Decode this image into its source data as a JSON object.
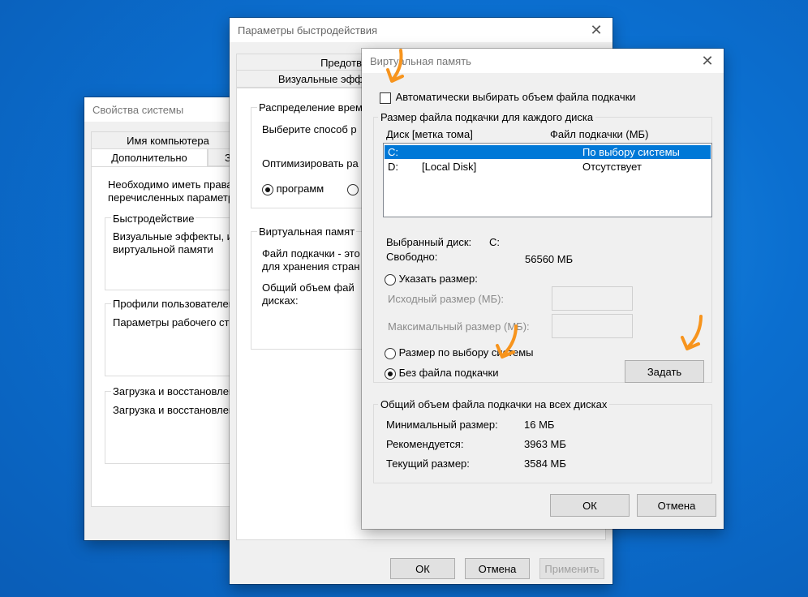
{
  "system_props": {
    "title": "Свойства системы",
    "tab_computer_name": "Имя компьютера",
    "tab_advanced": "Дополнительно",
    "tab_partial": "З",
    "intro_line1": "Необходимо иметь права",
    "intro_line2": "перечисленных параметро",
    "perf_label": "Быстродействие",
    "perf_text1": "Визуальные эффекты, ис",
    "perf_text2": "виртуальной памяти",
    "profiles_label": "Профили пользователей",
    "profiles_text": "Параметры рабочего сто",
    "startup_label": "Загрузка и восстановлен",
    "startup_text": "Загрузка и восстановлен"
  },
  "perf_options": {
    "title": "Параметры быстродействия",
    "tab_prevention": "Предотв",
    "tab_visual": "Визуальные эфф",
    "sched_label": "Распределение врем",
    "sched_text": "Выберите способ р",
    "optimize_text": "Оптимизировать ра",
    "programs_label": "программ",
    "vm_label": "Виртуальная памят",
    "vm_text1": "Файл подкачки - это",
    "vm_text2": "для хранения стран",
    "vm_text3": "Общий объем фай",
    "vm_text4": "дисках:",
    "ok": "ОК",
    "cancel": "Отмена",
    "apply": "Применить"
  },
  "virtual_memory": {
    "title": "Виртуальная память",
    "auto_manage_label": "Автоматически выбирать объем файла подкачки",
    "auto_manage_checked": false,
    "per_drive_group": "Размер файла подкачки для каждого диска",
    "col_drive": "Диск [метка тома]",
    "col_paging": "Файл подкачки (МБ)",
    "drives": [
      {
        "drive": "C:",
        "label": "",
        "paging": "По выбору системы",
        "selected": true
      },
      {
        "drive": "D:",
        "label": "[Local Disk]",
        "paging": "Отсутствует",
        "selected": false
      }
    ],
    "selected_drive_label": "Выбранный диск:",
    "selected_drive_value": "C:",
    "free_label": "Свободно:",
    "free_value": "56560 МБ",
    "custom_size_label": "Указать размер:",
    "initial_size_label": "Исходный размер (МБ):",
    "max_size_label": "Максимальный размер (МБ):",
    "system_managed_label": "Размер по выбору системы",
    "no_paging_label": "Без файла подкачки",
    "selected_option": "no_paging",
    "set_button": "Задать",
    "total_group": "Общий объем файла подкачки на всех дисках",
    "min_label": "Минимальный размер:",
    "min_value": "16 МБ",
    "recommended_label": "Рекомендуется:",
    "recommended_value": "3963 МБ",
    "current_label": "Текущий размер:",
    "current_value": "3584 МБ",
    "ok": "ОК",
    "cancel": "Отмена"
  },
  "colors": {
    "desktop": "#0b6fd0",
    "selection": "#0078d7",
    "annotation_arrow": "#f7941d"
  }
}
